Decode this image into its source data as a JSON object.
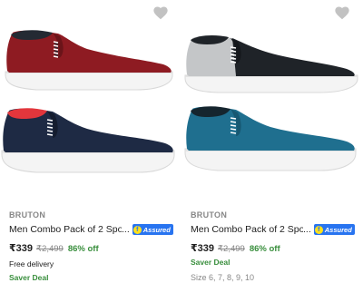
{
  "colors": {
    "maroon": "#8e1b22",
    "black": "#1f2328",
    "grey": "#c4c6c8",
    "navy": "#1e2a44",
    "teal": "#1f6f8f",
    "red_lining": "#e2363c",
    "sole": "#f4f4f4",
    "assured": "#2874f0",
    "discount": "#388e3c",
    "heart": "#c2c2c2"
  },
  "products": [
    {
      "brand": "BRUTON",
      "title": "Men Combo Pack of 2 Sports Sho",
      "ellipsis": "...",
      "assured": "Assured",
      "assured_icon": "flipkart-f-icon",
      "price": "₹339",
      "mrp": "₹2,499",
      "discount": "86% off",
      "delivery": "Free delivery",
      "deal": "Saver Deal",
      "shoes": [
        "maroon slip-on",
        "navy slip-on"
      ]
    },
    {
      "brand": "BRUTON",
      "title": "Men Combo Pack of 2 Sports Sho",
      "ellipsis": "...",
      "assured": "Assured",
      "assured_icon": "flipkart-f-icon",
      "price": "₹339",
      "mrp": "₹2,499",
      "discount": "86% off",
      "deal": "Saver Deal",
      "size": "Size 6, 7, 8, 9, 10",
      "shoes": [
        "black and grey slip-on",
        "teal slip-on"
      ]
    }
  ]
}
